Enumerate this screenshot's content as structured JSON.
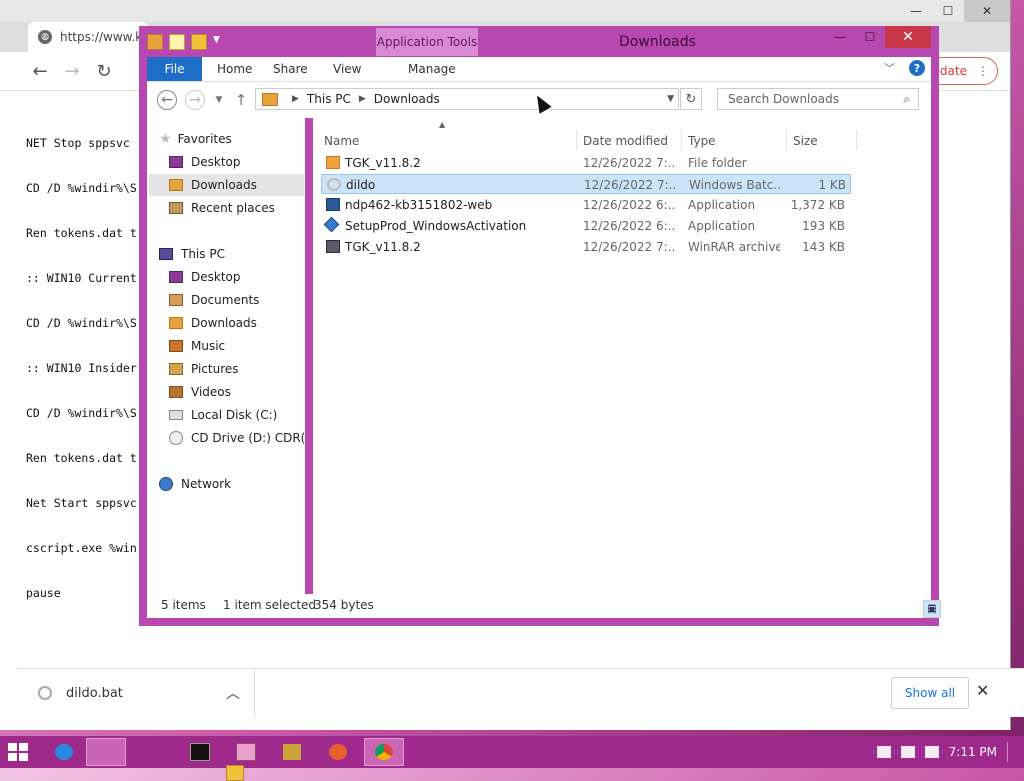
{
  "browser": {
    "tab_url": "https://www.k",
    "update_label": "pdate",
    "page_lines": [
      "NET Stop sppsvc",
      "CD /D %windir%\\S",
      "Ren tokens.dat t",
      ":: WIN10 Current",
      "CD /D %windir%\\S",
      ":: WIN10 Insider",
      "CD /D %windir%\\S",
      "Ren tokens.dat t",
      "Net Start sppsvc",
      "cscript.exe %win",
      "pause"
    ],
    "download_shelf": {
      "file_name": "dildo.bat",
      "show_all_label": "Show all"
    }
  },
  "explorer": {
    "context_tab": "Application Tools",
    "title": "Downloads",
    "ribbon_tabs": [
      "File",
      "Home",
      "Share",
      "View",
      "Manage"
    ],
    "address": {
      "segments": [
        "This PC",
        "Downloads"
      ]
    },
    "search_placeholder": "Search Downloads",
    "nav": {
      "favorites_label": "Favorites",
      "favorites": [
        "Desktop",
        "Downloads",
        "Recent places"
      ],
      "this_pc_label": "This PC",
      "this_pc": [
        "Desktop",
        "Documents",
        "Downloads",
        "Music",
        "Pictures",
        "Videos",
        "Local Disk (C:)",
        "CD Drive (D:) CDR("
      ],
      "network_label": "Network"
    },
    "columns": {
      "name": "Name",
      "date": "Date modified",
      "type": "Type",
      "size": "Size"
    },
    "files": [
      {
        "name": "TGK_v11.8.2",
        "date": "12/26/2022 7:...",
        "type": "File folder",
        "size": "",
        "icon": "folder-icon"
      },
      {
        "name": "dildo",
        "date": "12/26/2022 7:...",
        "type": "Windows Batc...",
        "size": "1 KB",
        "icon": "batch-file-icon"
      },
      {
        "name": "ndp462-kb3151802-web",
        "date": "12/26/2022 6:...",
        "type": "Application",
        "size": "1,372 KB",
        "icon": "installer-icon"
      },
      {
        "name": "SetupProd_WindowsActivation",
        "date": "12/26/2022 6:...",
        "type": "Application",
        "size": "193 KB",
        "icon": "app-icon"
      },
      {
        "name": "TGK_v11.8.2",
        "date": "12/26/2022 7:...",
        "type": "WinRAR archive",
        "size": "143 KB",
        "icon": "winrar-icon"
      }
    ],
    "status": {
      "items": "5 items",
      "selected": "1 item selected",
      "bytes": "354 bytes"
    }
  },
  "taskbar": {
    "time": "7:11 PM"
  },
  "colors": {
    "window_frame": "#b847b0",
    "file_tab": "#1e6ec8",
    "selection": "#cce4f7",
    "taskbar": "#a02a8c"
  }
}
